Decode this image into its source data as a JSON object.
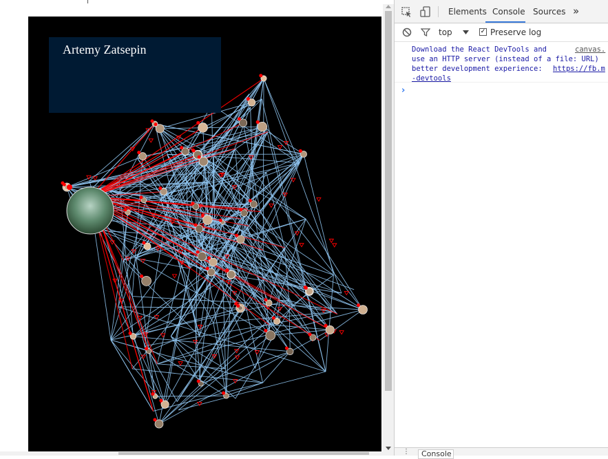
{
  "page": {
    "author_name": "Artemy Zatsepin"
  },
  "devtools": {
    "tabs": [
      "Elements",
      "Console",
      "Sources"
    ],
    "active_tab": "Console",
    "more_tabs_glyph": "»",
    "context": "top",
    "preserve_log_label": "Preserve log",
    "preserve_log_checked": true,
    "message": {
      "line1": "Download the React DevTools and",
      "source_link": "canvas.",
      "line2": "use an HTTP server (instead of a file: URL)",
      "line3": "better development experience: ",
      "url_part1": "https://fb.m",
      "url_part2": "-devtools"
    },
    "prompt_glyph": "›",
    "drawer_tab": "Console"
  },
  "colors": {
    "canvas_bg": "#000000",
    "edge_blue": "#8fc4f0",
    "edge_red": "#ff0000",
    "name_box": "#001a33",
    "devtools_accent": "#3879d9",
    "console_message": "#1a1aa6"
  }
}
